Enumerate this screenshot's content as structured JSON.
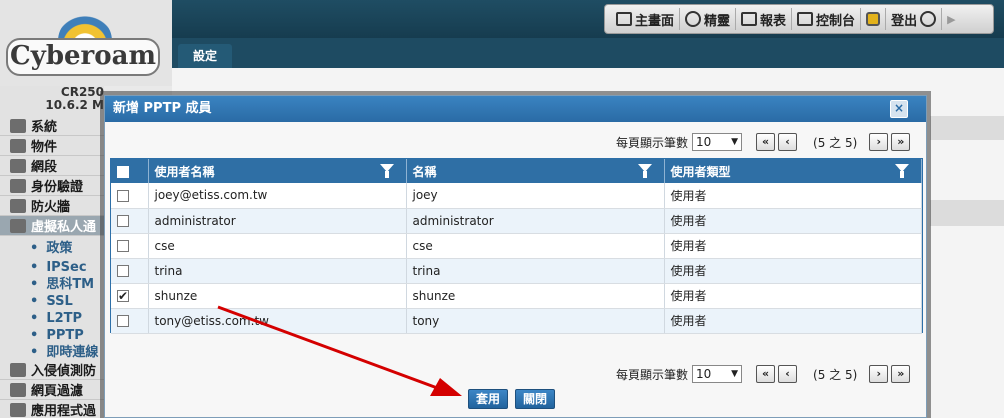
{
  "app": {
    "logo_text": "Cyberoam",
    "model_line1": "CR250",
    "model_line2": "10.6.2 M",
    "tab_label": "設定"
  },
  "topnav": {
    "items": [
      {
        "label": "主畫面",
        "icon": "monitor-icon"
      },
      {
        "label": "精靈",
        "icon": "chat-bubble-icon"
      },
      {
        "label": "報表",
        "icon": "report-icon"
      },
      {
        "label": "控制台",
        "icon": "console-icon"
      },
      {
        "label": "",
        "icon": "lock-icon"
      },
      {
        "label": "登出",
        "icon": "logout-icon"
      }
    ]
  },
  "sidebar": {
    "items": [
      {
        "label": "系統"
      },
      {
        "label": "物件"
      },
      {
        "label": "網段"
      },
      {
        "label": "身份驗證"
      },
      {
        "label": "防火牆"
      },
      {
        "label": "虛擬私人通"
      }
    ],
    "subitems": [
      {
        "label": "政策"
      },
      {
        "label": "IPSec"
      },
      {
        "label": "思科TM"
      },
      {
        "label": "SSL"
      },
      {
        "label": "L2TP"
      },
      {
        "label": "PPTP"
      },
      {
        "label": "即時連線"
      }
    ],
    "more_items": [
      {
        "label": "入侵偵測防"
      },
      {
        "label": "網頁過濾"
      },
      {
        "label": "應用程式過"
      }
    ]
  },
  "modal": {
    "title": "新增 PPTP 成員",
    "close_label": "×",
    "pager_top": {
      "label": "每頁顯示筆數",
      "page_size": "10",
      "info": "(5 之 5)"
    },
    "pager_bottom": {
      "label": "每頁顯示筆數",
      "page_size": "10",
      "info": "(5 之 5)"
    },
    "columns": [
      "使用者名稱",
      "名稱",
      "使用者類型"
    ],
    "rows": [
      {
        "checked": false,
        "username": "joey@etiss.com.tw",
        "name": "joey",
        "type": "使用者"
      },
      {
        "checked": false,
        "username": "administrator",
        "name": "administrator",
        "type": "使用者"
      },
      {
        "checked": false,
        "username": "cse",
        "name": "cse",
        "type": "使用者"
      },
      {
        "checked": false,
        "username": "trina",
        "name": "trina",
        "type": "使用者"
      },
      {
        "checked": true,
        "username": "shunze",
        "name": "shunze",
        "type": "使用者"
      },
      {
        "checked": false,
        "username": "tony@etiss.com.tw",
        "name": "tony",
        "type": "使用者"
      }
    ],
    "apply_label": "套用",
    "close_button_label": "關閉"
  },
  "colors": {
    "header_blue": "#2f6fa5",
    "topbar": "#1f4d63",
    "annotation_arrow": "#d40000"
  }
}
